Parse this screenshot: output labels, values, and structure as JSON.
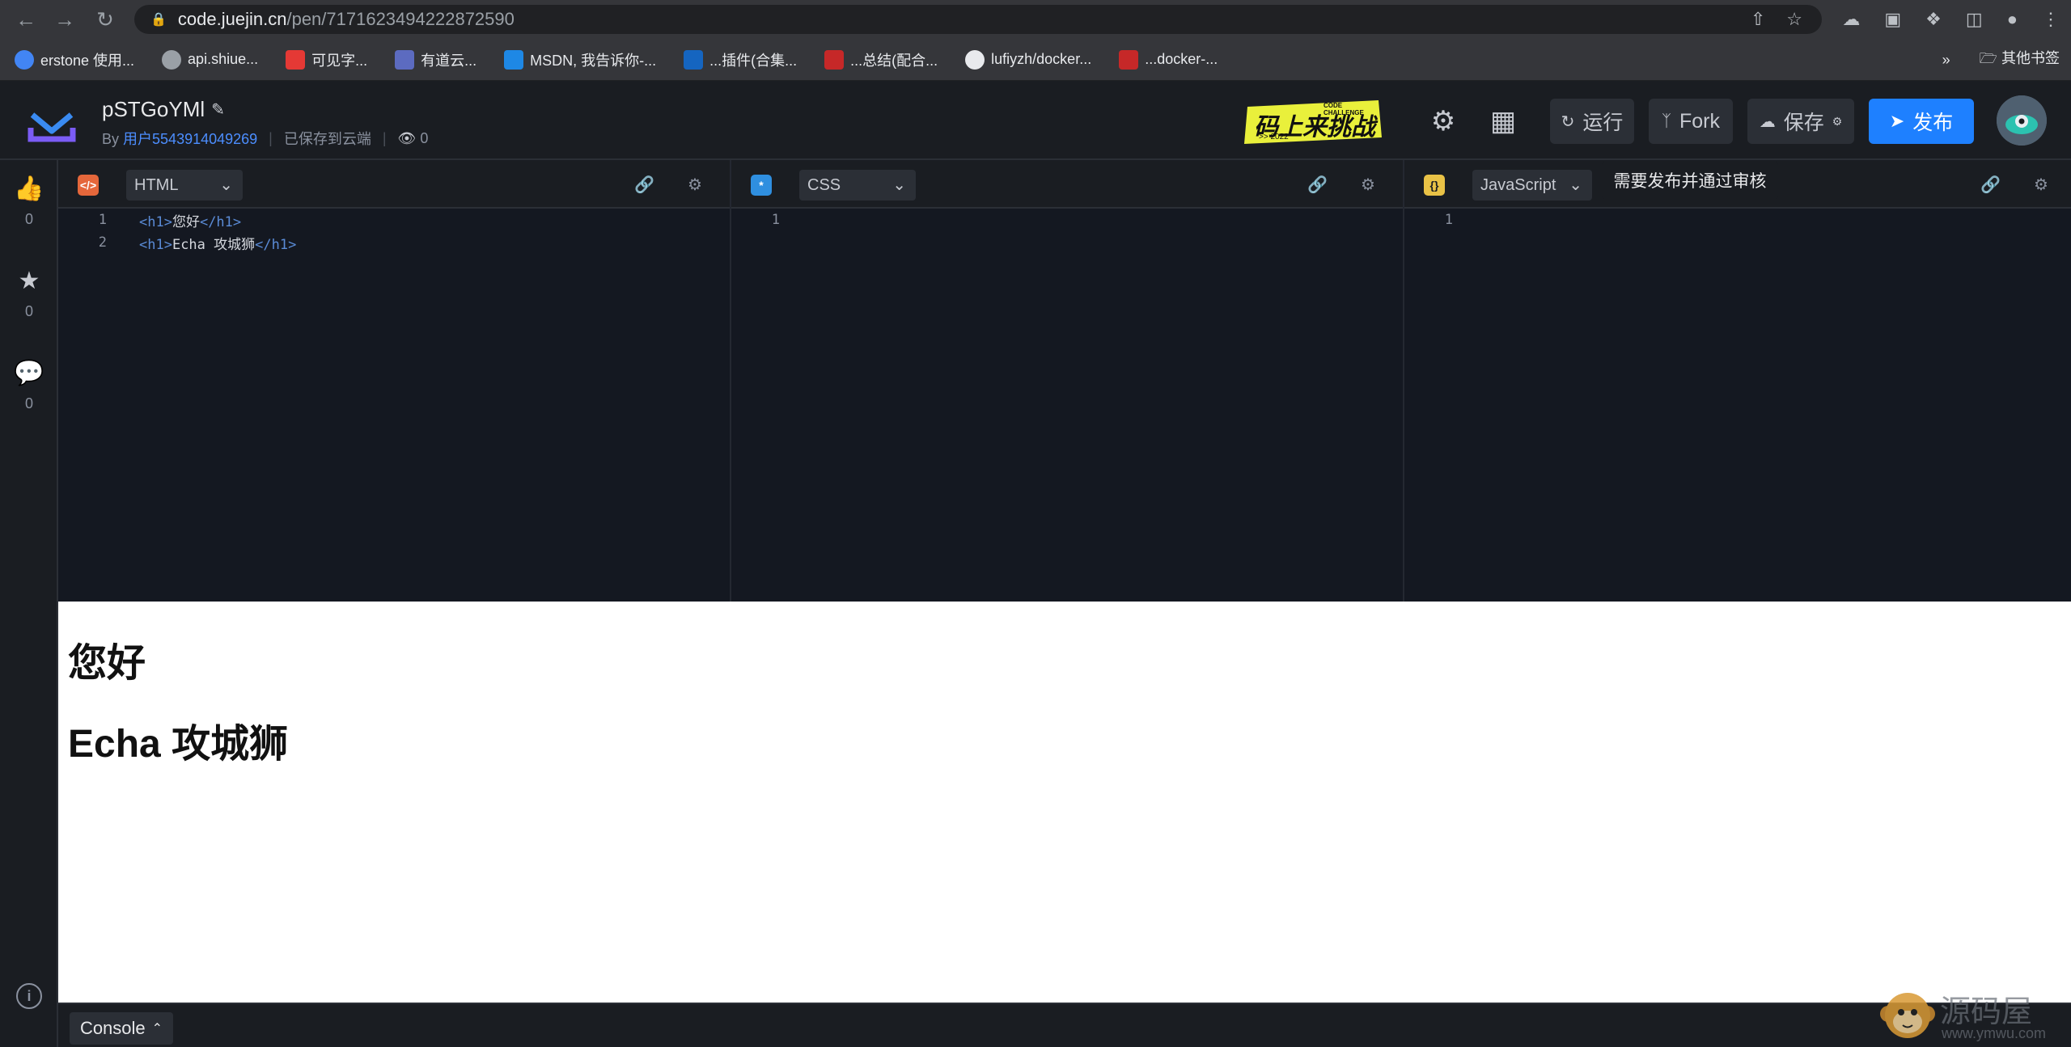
{
  "browser": {
    "url_host": "code.juejin.cn",
    "url_path": "/pen/7171623494222872590",
    "bookmarks": [
      {
        "label": "erstone 使用...",
        "color": "#4285f4"
      },
      {
        "label": "api.shiue...",
        "color": "#9aa0a6"
      },
      {
        "label": "可见字...",
        "color": "#e53935"
      },
      {
        "label": "有道云...",
        "color": "#5c6bc0"
      },
      {
        "label": "MSDN, 我告诉你-...",
        "color": "#1e88e5"
      },
      {
        "label": "...插件(合集...",
        "color": "#1565c0"
      },
      {
        "label": "...总结(配合...",
        "color": "#c62828"
      },
      {
        "label": "lufiyzh/docker...",
        "color": "#e8eaed"
      },
      {
        "label": "...docker-...",
        "color": "#c62828"
      }
    ],
    "more": "»",
    "other_bookmarks": "其他书签"
  },
  "header": {
    "title": "pSTGoYMl",
    "by": "By",
    "user": "用户5543914049269",
    "saved_status": "已保存到云端",
    "views": "0",
    "run_label": "运行",
    "fork_label": "Fork",
    "save_label": "保存",
    "publish_label": "发布",
    "challenge_main": "码上来挑战",
    "challenge_sub": "CODE CHALLENGE",
    "challenge_year": ">> 2022"
  },
  "sidebar": {
    "likes": "0",
    "stars": "0",
    "comments": "0"
  },
  "editors": [
    {
      "badge": "</>",
      "language": "HTML",
      "lines": [
        {
          "no": "1",
          "open": "<h1>",
          "text": "您好",
          "close": "</h1>"
        },
        {
          "no": "2",
          "open": "<h1>",
          "text": "Echa 攻城狮",
          "close": "</h1>"
        }
      ]
    },
    {
      "badge": "*",
      "language": "CSS",
      "lines": [
        {
          "no": "1"
        }
      ]
    },
    {
      "badge": "{}",
      "language": "JavaScript",
      "lines": [
        {
          "no": "1"
        }
      ]
    }
  ],
  "tooltip": "需要发布并通过审核",
  "preview": {
    "h1_first": "您好",
    "h1_second": "Echa 攻城狮"
  },
  "console": {
    "label": "Console"
  },
  "watermark": {
    "text": "源码屋",
    "url": "www.ymwu.com"
  },
  "colors": {
    "accent": "#1e80ff",
    "html_badge": "#e5673b",
    "css_badge": "#2f8fe0",
    "js_badge": "#e9c246"
  }
}
